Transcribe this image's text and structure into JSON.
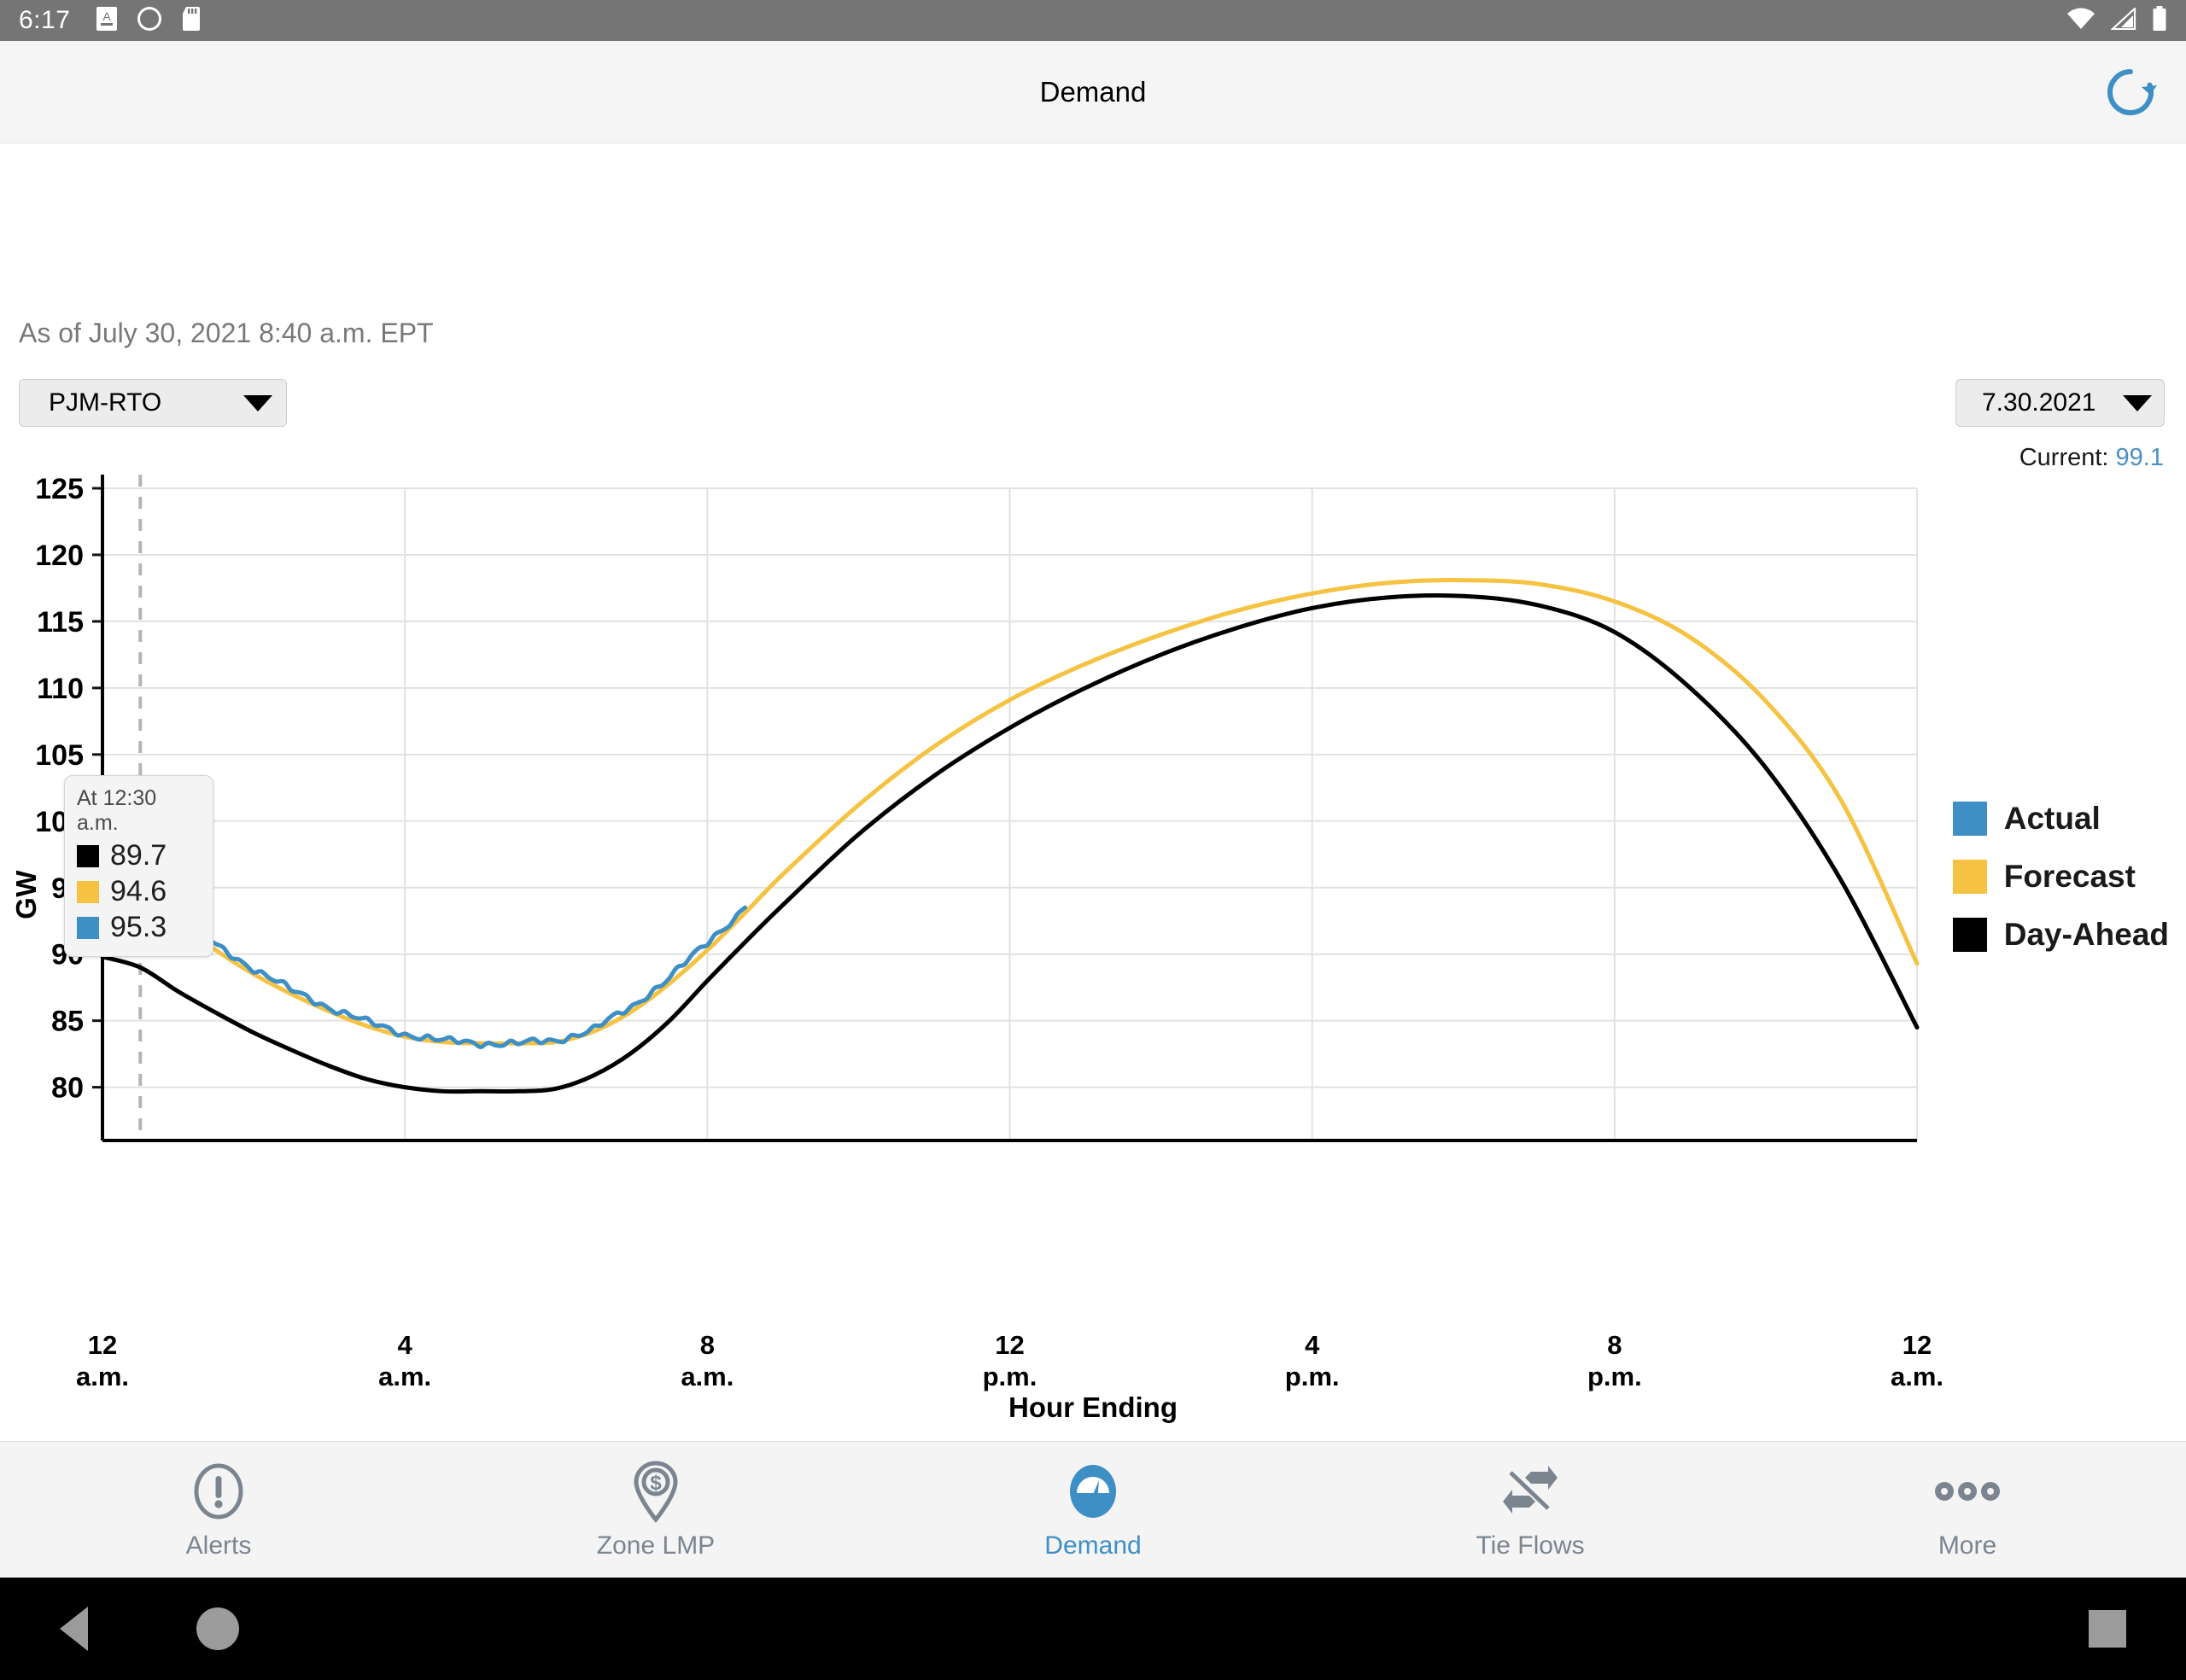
{
  "status_bar": {
    "clock": "6:17",
    "left_icons": [
      "screenshot-icon",
      "app-notification-icon",
      "sd-card-icon"
    ],
    "right_icons": [
      "wifi-icon",
      "cell-signal-icon",
      "battery-icon"
    ]
  },
  "app_bar": {
    "title": "Demand",
    "refresh_icon": "refresh-icon",
    "accent": "#3e8fc6"
  },
  "content": {
    "as_of": "As of July 30, 2021 8:40 a.m. EPT",
    "region_dropdown": {
      "value": "PJM-RTO"
    },
    "date_dropdown": {
      "value": "7.30.2021"
    },
    "current": {
      "label": "Current:",
      "value": "99.1",
      "color": "#4a90c4"
    }
  },
  "tooltip": {
    "time": "At 12:30 a.m.",
    "rows": [
      {
        "series": "Day-Ahead",
        "color": "#000000",
        "value": "89.7"
      },
      {
        "series": "Forecast",
        "color": "#f5c242",
        "value": "94.6"
      },
      {
        "series": "Actual",
        "color": "#3e8fc6",
        "value": "95.3"
      }
    ]
  },
  "legend": [
    {
      "label": "Actual",
      "color": "#3e8fc6"
    },
    {
      "label": "Forecast",
      "color": "#f5c242"
    },
    {
      "label": "Day-Ahead",
      "color": "#000000"
    }
  ],
  "chart_data": {
    "type": "line",
    "title": "",
    "xlabel": "Hour Ending",
    "ylabel": "GW",
    "ylim": [
      76,
      125
    ],
    "yticks": [
      80,
      85,
      90,
      95,
      100,
      105,
      110,
      115,
      120,
      125
    ],
    "ytick_labels": [
      "80",
      "85",
      "90",
      "95",
      "100",
      "105",
      "110",
      "115",
      "120",
      "125"
    ],
    "grid": true,
    "legend_position": "right",
    "xlim": [
      0,
      24
    ],
    "xticks": [
      0,
      4,
      8,
      12,
      16,
      20,
      24
    ],
    "xtick_labels": [
      [
        "12",
        "a.m."
      ],
      [
        "4",
        "a.m."
      ],
      [
        "8",
        "a.m."
      ],
      [
        "12",
        "p.m."
      ],
      [
        "4",
        "p.m."
      ],
      [
        "8",
        "p.m."
      ],
      [
        "12",
        "a.m."
      ]
    ],
    "marker_line_x": 0.5,
    "x": [
      0,
      0.5,
      1,
      1.5,
      2,
      2.5,
      3,
      3.5,
      4,
      4.5,
      5,
      5.5,
      6,
      6.5,
      7,
      7.5,
      8,
      8.5,
      9,
      10,
      11,
      12,
      13,
      14,
      15,
      16,
      17,
      18,
      19,
      20,
      21,
      22,
      23,
      24
    ],
    "series": [
      {
        "name": "Day-Ahead",
        "color": "#000000",
        "values": [
          89.8,
          89.0,
          87.2,
          85.6,
          84.1,
          82.8,
          81.6,
          80.6,
          80.0,
          79.7,
          79.7,
          79.7,
          79.9,
          80.9,
          82.6,
          85.0,
          88.0,
          90.9,
          93.7,
          99.0,
          103.4,
          107.0,
          110.0,
          112.5,
          114.5,
          116.0,
          116.8,
          116.9,
          116.2,
          114.2,
          110.0,
          104.0,
          95.5,
          84.5
        ]
      },
      {
        "name": "Forecast",
        "color": "#f5c242",
        "values": [
          94.6,
          94.6,
          92.4,
          90.3,
          88.5,
          87.0,
          85.7,
          84.6,
          83.8,
          83.4,
          83.3,
          83.3,
          83.4,
          84.2,
          85.7,
          87.8,
          90.3,
          93.1,
          96.0,
          101.2,
          105.6,
          109.1,
          111.8,
          114.0,
          115.8,
          117.1,
          117.9,
          118.1,
          117.8,
          116.5,
          113.8,
          109.0,
          101.5,
          89.3
        ]
      },
      {
        "name": "Actual",
        "color": "#3e8fc6",
        "values": [
          96.2,
          95.3,
          93.0,
          90.7,
          88.9,
          87.3,
          86.0,
          84.9,
          84.0,
          83.5,
          83.3,
          83.3,
          83.5,
          84.4,
          86.0,
          88.3,
          90.8,
          93.5,
          null,
          null,
          null,
          null,
          null,
          null,
          null,
          null,
          null,
          null,
          null,
          null,
          null,
          null,
          null,
          null
        ]
      }
    ]
  },
  "bottom_nav": [
    {
      "label": "Alerts",
      "icon": "alert-circle-icon",
      "active": false
    },
    {
      "label": "Zone LMP",
      "icon": "map-pin-dollar-icon",
      "active": false
    },
    {
      "label": "Demand",
      "icon": "gauge-icon",
      "active": true
    },
    {
      "label": "Tie Flows",
      "icon": "tie-flows-arrows-icon",
      "active": false
    },
    {
      "label": "More",
      "icon": "more-dots-icon",
      "active": false
    }
  ],
  "android_nav": {
    "back": "back-triangle-icon",
    "home": "home-circle-icon",
    "recents": "recents-square-icon"
  }
}
